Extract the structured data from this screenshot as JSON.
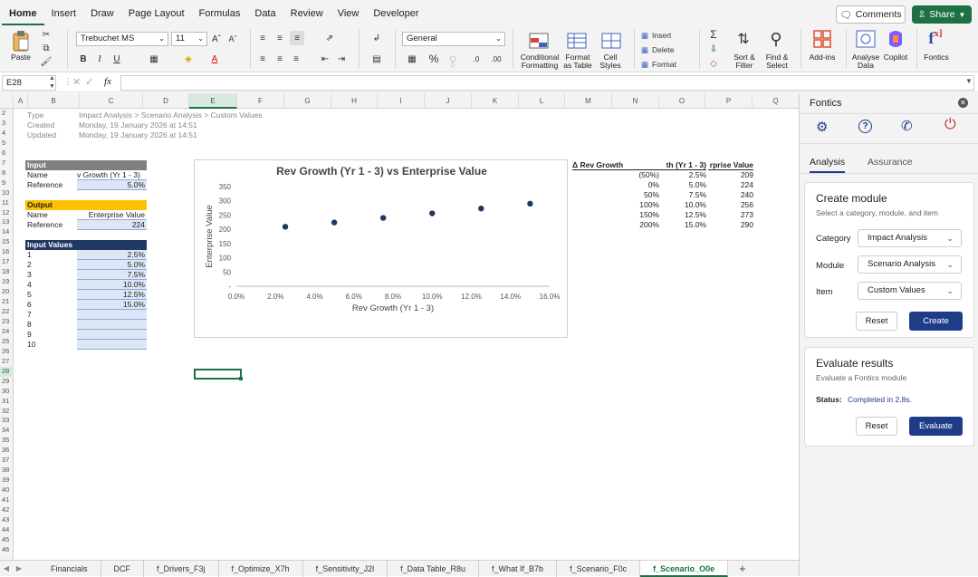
{
  "menu": {
    "tabs": [
      "Home",
      "Insert",
      "Draw",
      "Page Layout",
      "Formulas",
      "Data",
      "Review",
      "View",
      "Developer"
    ],
    "comments_label": "Comments",
    "share_label": "Share"
  },
  "ribbon": {
    "paste_label": "Paste",
    "font_name": "Trebuchet MS",
    "font_size": "11",
    "number_format": "General",
    "conditional_formatting": [
      "Conditional",
      "Formatting"
    ],
    "format_as_table": [
      "Format",
      "as Table"
    ],
    "cell_styles": [
      "Cell",
      "Styles"
    ],
    "insert_label": "Insert",
    "delete_label": "Delete",
    "format_label": "Format",
    "sort_filter": [
      "Sort &",
      "Filter"
    ],
    "find_select": [
      "Find &",
      "Select"
    ],
    "addins_label": "Add-ins",
    "analyse_data": [
      "Analyse",
      "Data"
    ],
    "copilot_label": "Copilot",
    "fontics_label": "Fontics"
  },
  "formula_bar": {
    "cell_ref": "E28",
    "fx": "fx",
    "content": ""
  },
  "sheet": {
    "columns": [
      "A",
      "B",
      "C",
      "D",
      "E",
      "F",
      "G",
      "H",
      "I",
      "J",
      "K",
      "L",
      "M",
      "N",
      "O",
      "P",
      "Q"
    ],
    "selected_column": "E",
    "first_row": 2,
    "last_row": 46,
    "selected_row": 28,
    "meta": {
      "type_label": "Type",
      "type_value": "Impact Analysis > Scenario Analysis > Custom Values",
      "created_label": "Created",
      "created_value": "Monday, 19 January 2026 at 14:51",
      "updated_label": "Updated",
      "updated_value": "Monday, 19 January 2026 at 14:51"
    },
    "input": {
      "header": "Input",
      "name_label": "Name",
      "name_value": "v Growth (Yr 1 - 3)",
      "ref_label": "Reference",
      "ref_value": "5.0%"
    },
    "output": {
      "header": "Output",
      "name_label": "Name",
      "name_value": "Enterprise Value",
      "ref_label": "Reference",
      "ref_value": "224"
    },
    "input_values": {
      "header": "Input Values",
      "indexes": [
        "1",
        "2",
        "3",
        "4",
        "5",
        "6",
        "7",
        "8",
        "9",
        "10"
      ],
      "values": [
        "2.5%",
        "5.0%",
        "7.5%",
        "10.0%",
        "12.5%",
        "15.0%",
        "",
        "",
        "",
        ""
      ]
    },
    "results_table": {
      "headers": [
        "Δ Rev Growth",
        "th (Yr 1 - 3)",
        "rprise Value"
      ],
      "rows": [
        [
          "(50%)",
          "2.5%",
          "209"
        ],
        [
          "0%",
          "5.0%",
          "224"
        ],
        [
          "50%",
          "7.5%",
          "240"
        ],
        [
          "100%",
          "10.0%",
          "256"
        ],
        [
          "150%",
          "12.5%",
          "273"
        ],
        [
          "200%",
          "15.0%",
          "290"
        ]
      ]
    }
  },
  "chart_data": {
    "type": "scatter",
    "title": "Rev Growth (Yr 1 - 3) vs Enterprise Value",
    "xlabel": "Rev Growth (Yr 1 - 3)",
    "ylabel": "Enterprise Value",
    "xlim": [
      0,
      0.16
    ],
    "ylim": [
      0,
      350
    ],
    "x_ticks": [
      "0.0%",
      "2.0%",
      "4.0%",
      "6.0%",
      "8.0%",
      "10.0%",
      "12.0%",
      "14.0%",
      "16.0%"
    ],
    "y_ticks": [
      "-",
      "50",
      "100",
      "150",
      "200",
      "250",
      "300",
      "350"
    ],
    "x": [
      0.025,
      0.05,
      0.075,
      0.1,
      0.125,
      0.15
    ],
    "y": [
      209,
      224,
      240,
      256,
      273,
      290
    ],
    "point_color": "#1f3864",
    "grid": false
  },
  "sheet_tabs": {
    "tabs": [
      "Financials",
      "DCF",
      "f_Drivers_F3j",
      "f_Optimize_X7h",
      "f_Sensitivity_J2l",
      "f_Data Table_R8u",
      "f_What If_B7b",
      "f_Scenario_F0c",
      "f_Scenario_O0e"
    ],
    "active": "f_Scenario_O0e",
    "add_label": "+"
  },
  "panel": {
    "title": "Fontics",
    "tabs": [
      "Analysis",
      "Assurance"
    ],
    "create": {
      "title": "Create module",
      "subtitle": "Select a category, module, and item",
      "category_label": "Category",
      "category_value": "Impact Analysis",
      "module_label": "Module",
      "module_value": "Scenario Analysis",
      "item_label": "Item",
      "item_value": "Custom Values",
      "reset_label": "Reset",
      "create_label": "Create"
    },
    "evaluate": {
      "title": "Evaluate results",
      "subtitle": "Evaluate a Fontics module",
      "status_label": "Status:",
      "status_value": "Completed in 2.8s.",
      "reset_label": "Reset",
      "evaluate_label": "Evaluate"
    }
  },
  "colors": {
    "excel_green": "#1e7145",
    "navy": "#1f3864",
    "gold": "#ffc000",
    "primary_button": "#1f3c88"
  }
}
